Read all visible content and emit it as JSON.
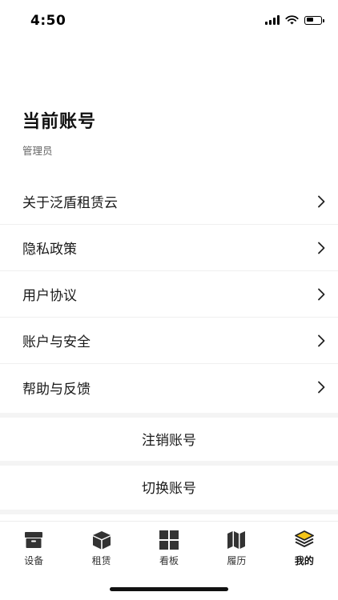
{
  "status_bar": {
    "time": "4:50",
    "icons": [
      "cellular-signal-icon",
      "wifi-icon",
      "battery-icon"
    ],
    "battery_level_percent": 55
  },
  "account": {
    "title": "当前账号",
    "role": "管理员"
  },
  "menu": {
    "items": [
      {
        "label": "关于泛盾租赁云",
        "icon": "chevron-right-icon"
      },
      {
        "label": "隐私政策",
        "icon": "chevron-right-icon"
      },
      {
        "label": "用户协议",
        "icon": "chevron-right-icon"
      },
      {
        "label": "账户与安全",
        "icon": "chevron-right-icon"
      },
      {
        "label": "帮助与反馈",
        "icon": "chevron-right-icon"
      }
    ]
  },
  "actions": {
    "cancel_account": "注销账号",
    "switch_account": "切换账号"
  },
  "tabbar": {
    "tabs": [
      {
        "label": "设备",
        "icon": "box-icon"
      },
      {
        "label": "租赁",
        "icon": "cube-icon"
      },
      {
        "label": "看板",
        "icon": "dashboard-grid-icon"
      },
      {
        "label": "履历",
        "icon": "map-icon"
      },
      {
        "label": "我的",
        "icon": "layers-icon",
        "active": true
      }
    ]
  },
  "colors": {
    "text": "#1a1a1a",
    "secondary_text": "#666666",
    "separator": "#f4f4f4",
    "active_tab_accent": "#f5c518"
  }
}
